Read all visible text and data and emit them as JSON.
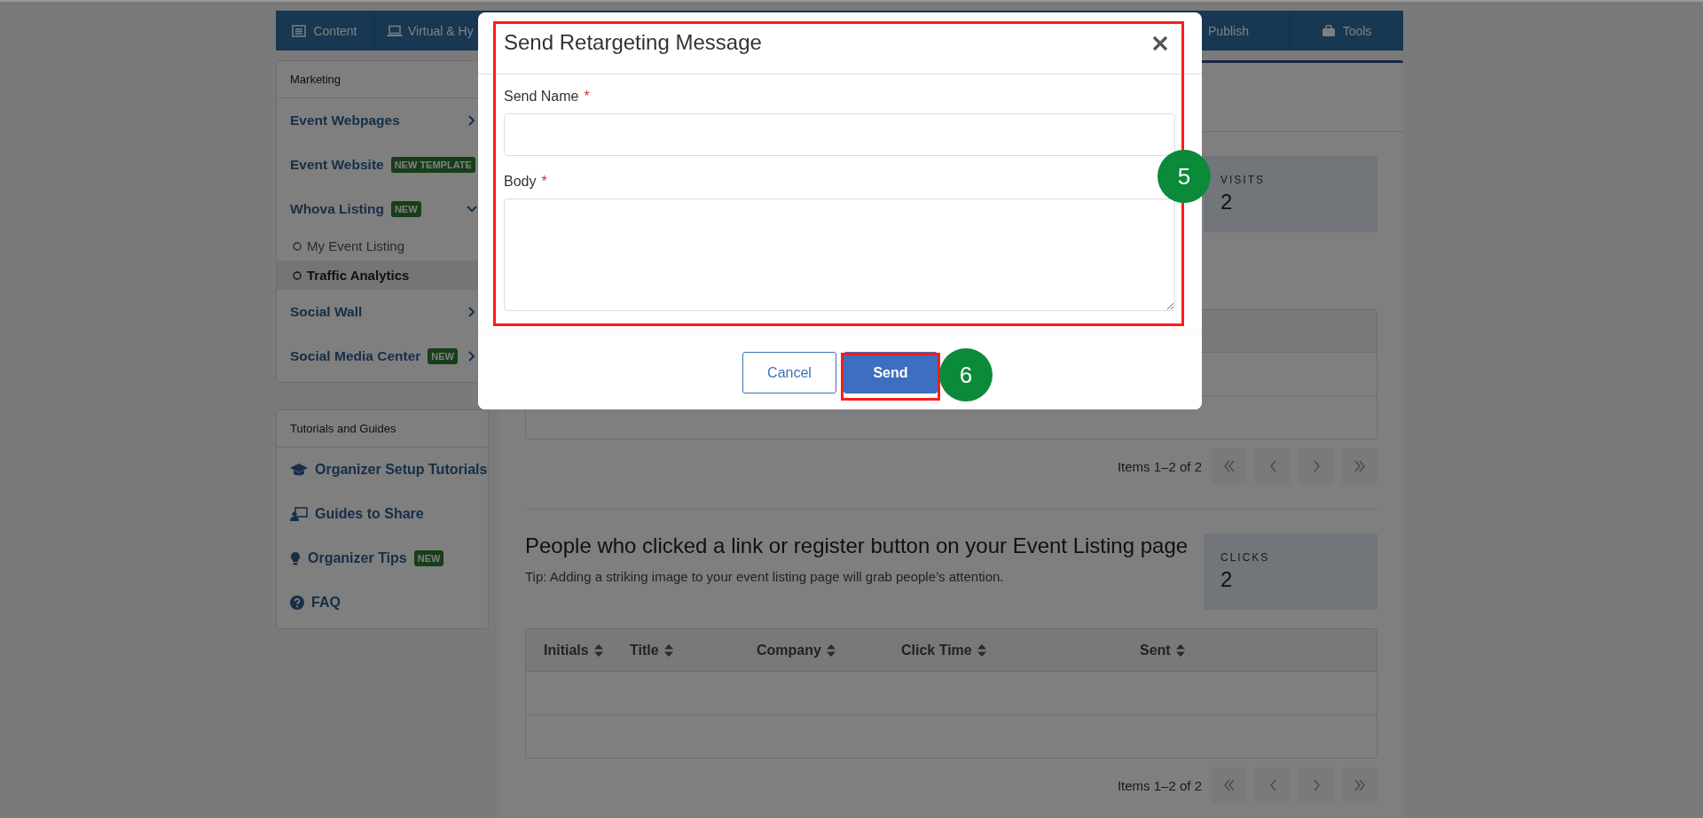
{
  "nav_tabs": [
    {
      "label": "Content"
    },
    {
      "label": "Virtual & Hy"
    },
    {
      "label": "Publish"
    },
    {
      "label": "Tools"
    }
  ],
  "sidebar": {
    "marketing": {
      "title": "Marketing",
      "items": [
        {
          "label": "Event Webpages",
          "expanded": false
        },
        {
          "label": "Event Website",
          "badge": "NEW TEMPLATE"
        },
        {
          "label": "Whova Listing",
          "badge": "NEW",
          "expanded": true,
          "children": [
            {
              "label": "My Event Listing",
              "selected": false
            },
            {
              "label": "Traffic Analytics",
              "selected": true
            }
          ]
        },
        {
          "label": "Social Wall",
          "expanded": false
        },
        {
          "label": "Social Media Center",
          "badge": "NEW",
          "expanded": false
        }
      ]
    },
    "tutorials": {
      "title": "Tutorials and Guides",
      "items": [
        {
          "label": "Organizer Setup Tutorials"
        },
        {
          "label": "Guides to Share"
        },
        {
          "label": "Organizer Tips",
          "badge": "NEW"
        },
        {
          "label": "FAQ"
        }
      ]
    }
  },
  "visits_section": {
    "stat": {
      "label": "VISITS",
      "value": "2"
    },
    "pagination": "Items 1–2 of 2"
  },
  "clicks_section": {
    "heading": "People who clicked a link or register button on your Event Listing page",
    "tip": "Tip: Adding a striking image to your event listing page will grab people’s attention.",
    "stat": {
      "label": "CLICKS",
      "value": "2"
    },
    "table": {
      "columns": [
        "Initials",
        "Title",
        "Company",
        "Click Time",
        "Sent"
      ]
    },
    "pagination": "Items 1–2 of 2"
  },
  "modal": {
    "title": "Send Retargeting Message",
    "fields": [
      {
        "label": "Send Name",
        "required_mark": "*",
        "kind": "input"
      },
      {
        "label": "Body",
        "required_mark": "*",
        "kind": "textarea"
      }
    ],
    "buttons": [
      {
        "label": "Cancel",
        "kind": "secondary"
      },
      {
        "label": "Send",
        "kind": "primary"
      }
    ]
  },
  "annotations": [
    {
      "label": "5"
    },
    {
      "label": "6"
    }
  ]
}
